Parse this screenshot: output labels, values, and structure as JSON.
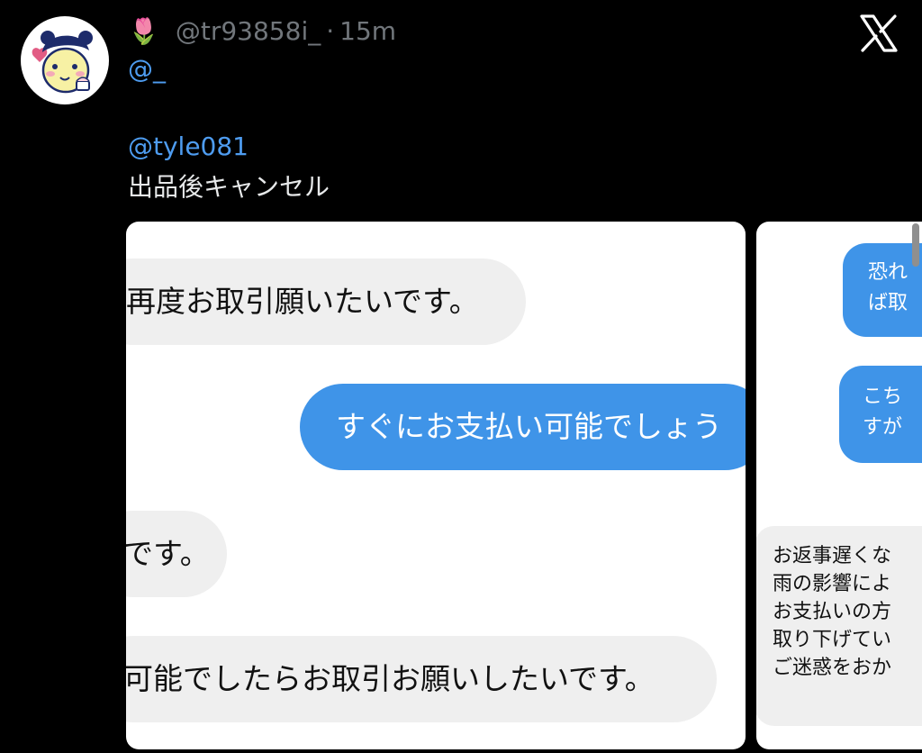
{
  "tweet": {
    "emoji": "🌷",
    "handle": "@tr93858i_",
    "separator": "·",
    "time": "15m",
    "reply_mention": "@_",
    "mention": "@tyle081",
    "text": "出品後キャンセル"
  },
  "images": [
    {
      "bubbles": [
        {
          "type": "received",
          "text": "再度お取引願いたいです。"
        },
        {
          "type": "sent",
          "text": "すぐにお支払い可能でしょう"
        },
        {
          "type": "received",
          "text": "です。"
        },
        {
          "type": "received",
          "text": "可能でしたらお取引お願いしたいです。"
        }
      ]
    },
    {
      "bubbles": [
        {
          "type": "sent",
          "text": "恐れ\nば取"
        },
        {
          "type": "sent",
          "text": "こち\nすが"
        },
        {
          "type": "received",
          "text": "お返事遅くな\n雨の影響によ\nお支払いの方\n取り下げてい\nご迷惑をおか"
        }
      ]
    }
  ],
  "colors": {
    "background": "#000000",
    "mention": "#4e9cf0",
    "sent_bubble": "#3f94e8",
    "received_bubble": "#efefef"
  },
  "icons": {
    "brand": "x-logo-icon",
    "avatar": "character-avatar"
  }
}
